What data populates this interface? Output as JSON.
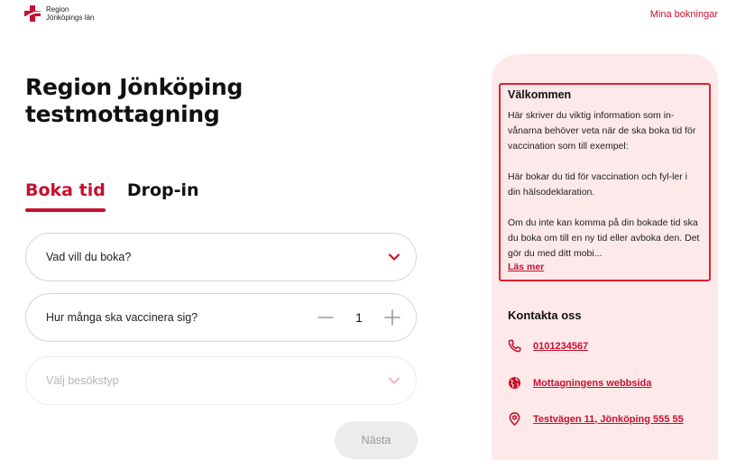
{
  "header": {
    "logo_line1": "Region",
    "logo_line2": "Jönköpings län",
    "bookings_link": "Mina bokningar"
  },
  "main": {
    "title": "Region Jönköping testmottagning",
    "tabs": [
      {
        "label": "Boka tid",
        "active": true
      },
      {
        "label": "Drop-in",
        "active": false
      }
    ],
    "booking_select": {
      "label": "Vad vill du boka?"
    },
    "count_field": {
      "label": "Hur många ska vaccinera sig?",
      "value": "1"
    },
    "visit_type_select": {
      "label": "Välj besökstyp",
      "disabled": true
    },
    "next_button": "Nästa"
  },
  "sidebar": {
    "welcome": {
      "title": "Välkommen",
      "para1": "Här skriver du viktig information som in-vånarna behöver veta när de ska boka tid för vaccination som till exempel:",
      "para2": "Här bokar du tid för vaccination och fyl-ler i din hälsodeklaration.",
      "para3": "Om du inte kan komma på din bokade tid ska du boka om till en ny tid eller avboka den. Det gör du med ditt mobi...",
      "read_more": "Läs mer"
    },
    "contact": {
      "title": "Kontakta oss",
      "phone": "0101234567",
      "website": "Mottagningens webbsida",
      "address": "Testvägen 11, Jönköping 555 55"
    }
  },
  "colors": {
    "accent": "#c8102e",
    "sidebar_bg": "#fde9ea",
    "highlight_border": "#e0202e"
  },
  "icons": [
    "logo-cross-icon",
    "chevron-down-icon",
    "minus-icon",
    "plus-icon",
    "phone-icon",
    "globe-icon",
    "location-pin-icon"
  ]
}
